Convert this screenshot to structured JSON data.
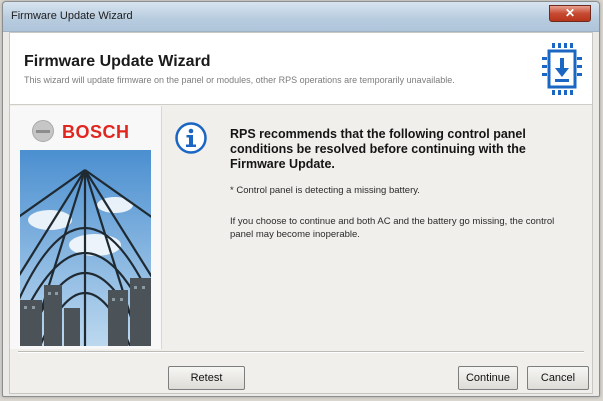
{
  "window": {
    "title": "Firmware Update Wizard",
    "close_label": "✕"
  },
  "header": {
    "title": "Firmware Update Wizard",
    "subtitle": "This wizard will update firmware on the panel or modules, other RPS operations are temporarily unavailable.",
    "icon": "chip-download-icon"
  },
  "brand": {
    "name": "BOSCH",
    "color": "#e0261f"
  },
  "message": {
    "icon": "info-icon",
    "headline": "RPS recommends that the following control panel conditions be resolved before continuing with the Firmware Update.",
    "condition": "* Control panel is detecting a missing battery.",
    "warning": "If you choose to continue and both AC and the battery go missing, the control panel may become inoperable."
  },
  "buttons": {
    "retest": "Retest",
    "continue": "Continue",
    "cancel": "Cancel"
  },
  "colors": {
    "accent": "#1a66c2",
    "titlebar": "#b9cde0"
  }
}
